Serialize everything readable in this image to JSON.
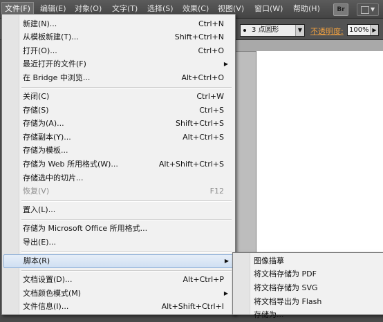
{
  "menubar": {
    "items": [
      "文件(F)",
      "编辑(E)",
      "对象(O)",
      "文字(T)",
      "选择(S)",
      "效果(C)",
      "视图(V)",
      "窗口(W)",
      "帮助(H)"
    ],
    "bridge_button": "Br"
  },
  "control_bar": {
    "brush_label": "3 点圆形",
    "opacity_label": "不透明度:",
    "opacity_value": "100%"
  },
  "file_menu": {
    "items": [
      {
        "label": "新建(N)...",
        "shortcut": "Ctrl+N"
      },
      {
        "label": "从模板新建(T)...",
        "shortcut": "Shift+Ctrl+N"
      },
      {
        "label": "打开(O)...",
        "shortcut": "Ctrl+O"
      },
      {
        "label": "最近打开的文件(F)",
        "shortcut": ""
      },
      {
        "label": "在 Bridge 中浏览...",
        "shortcut": "Alt+Ctrl+O"
      },
      {
        "label": "关闭(C)",
        "shortcut": "Ctrl+W"
      },
      {
        "label": "存储(S)",
        "shortcut": "Ctrl+S"
      },
      {
        "label": "存储为(A)...",
        "shortcut": "Shift+Ctrl+S"
      },
      {
        "label": "存储副本(Y)...",
        "shortcut": "Alt+Ctrl+S"
      },
      {
        "label": "存储为模板...",
        "shortcut": ""
      },
      {
        "label": "存储为 Web 所用格式(W)...",
        "shortcut": "Alt+Shift+Ctrl+S"
      },
      {
        "label": "存储选中的切片...",
        "shortcut": ""
      },
      {
        "label": "恢复(V)",
        "shortcut": "F12"
      },
      {
        "label": "置入(L)...",
        "shortcut": ""
      },
      {
        "label": "存储为 Microsoft Office 所用格式...",
        "shortcut": ""
      },
      {
        "label": "导出(E)...",
        "shortcut": ""
      },
      {
        "label": "脚本(R)",
        "shortcut": ""
      },
      {
        "label": "文档设置(D)...",
        "shortcut": "Alt+Ctrl+P"
      },
      {
        "label": "文档颜色模式(M)",
        "shortcut": ""
      },
      {
        "label": "文件信息(I)...",
        "shortcut": "Alt+Shift+Ctrl+I"
      }
    ]
  },
  "scripts_submenu": {
    "items": [
      "图像描摹",
      "将文档存储为 PDF",
      "将文档存储为 SVG",
      "将文档导出为 Flash",
      "存储为..."
    ]
  }
}
